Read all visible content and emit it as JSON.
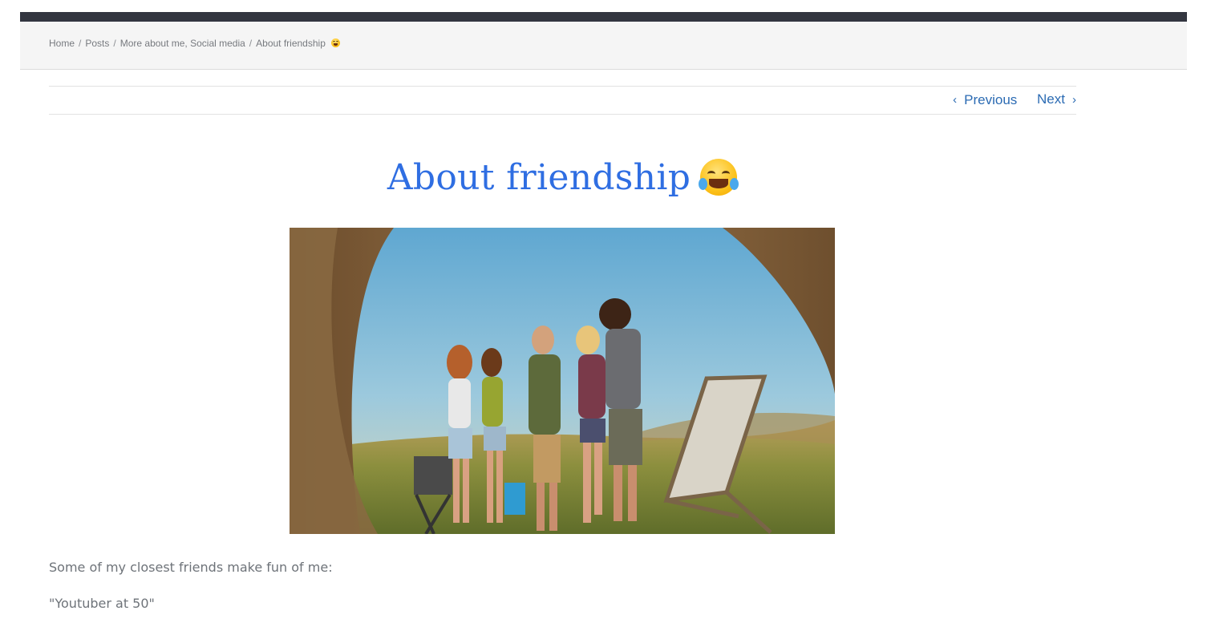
{
  "breadcrumb": {
    "home": "Home",
    "posts": "Posts",
    "categories": "More about me, Social media",
    "current": "About friendship",
    "current_emoji": "face-with-tears-of-joy-icon"
  },
  "post_nav": {
    "previous": "Previous",
    "next": "Next",
    "link_color": "#2b6bb3"
  },
  "post": {
    "title": "About friendship",
    "title_emoji": "face-with-tears-of-joy-icon",
    "title_color": "#2f6ee2",
    "image": "friends-camping-photo",
    "paragraphs": [
      "Some of my closest friends make fun of me:",
      "\"Youtuber at 50\""
    ]
  },
  "colors": {
    "topbar": "#333640",
    "breadcrumb_bg": "#f5f5f5",
    "body_text": "#6e7379"
  }
}
